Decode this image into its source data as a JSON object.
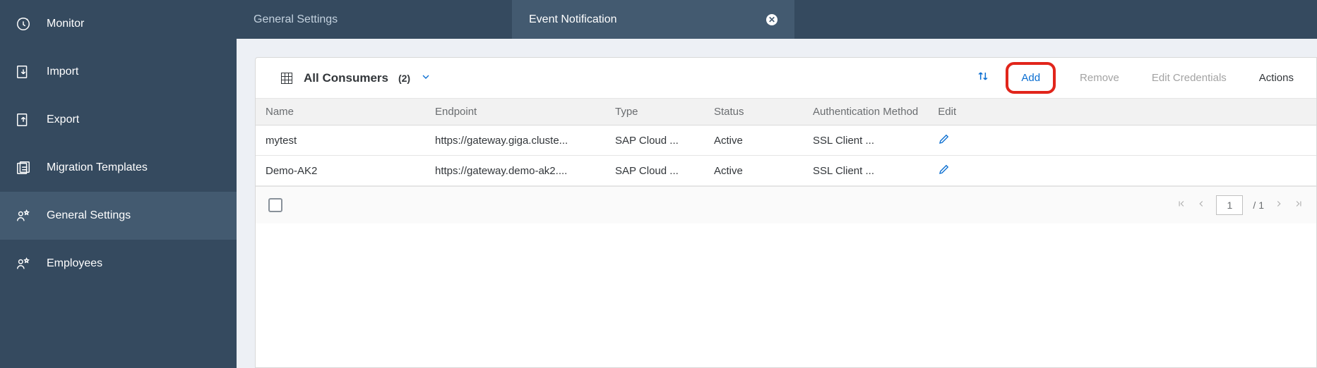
{
  "sidebar": {
    "items": [
      {
        "label": "Monitor",
        "icon": "monitor"
      },
      {
        "label": "Import",
        "icon": "import"
      },
      {
        "label": "Export",
        "icon": "export"
      },
      {
        "label": "Migration Templates",
        "icon": "migration"
      },
      {
        "label": "General Settings",
        "icon": "settings"
      },
      {
        "label": "Employees",
        "icon": "employees"
      }
    ]
  },
  "tabs": [
    {
      "label": "General Settings"
    },
    {
      "label": "Event Notification"
    }
  ],
  "toolbar": {
    "title": "All Consumers",
    "count": "(2)",
    "add": "Add",
    "remove": "Remove",
    "edit_credentials": "Edit Credentials",
    "actions": "Actions"
  },
  "table": {
    "headers": {
      "name": "Name",
      "endpoint": "Endpoint",
      "type": "Type",
      "status": "Status",
      "auth": "Authentication Method",
      "edit": "Edit"
    },
    "rows": [
      {
        "name": "mytest",
        "endpoint": "https://gateway.giga.cluste...",
        "type": "SAP Cloud ...",
        "status": "Active",
        "auth": "SSL Client ..."
      },
      {
        "name": "Demo-AK2",
        "endpoint": "https://gateway.demo-ak2....",
        "type": "SAP Cloud ...",
        "status": "Active",
        "auth": "SSL Client ..."
      }
    ]
  },
  "pager": {
    "current": "1",
    "total": "/ 1"
  }
}
